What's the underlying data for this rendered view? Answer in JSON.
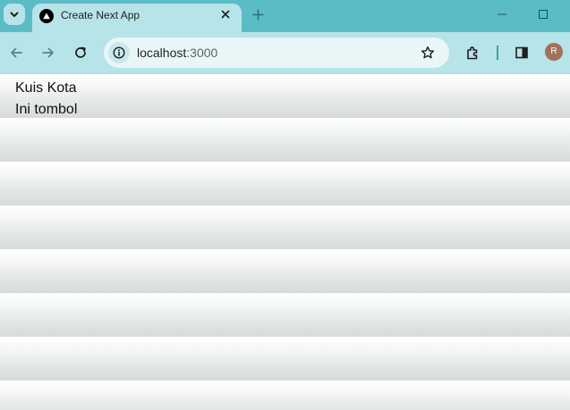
{
  "tab": {
    "title": "Create Next App",
    "favicon": "nextjs-triangle-icon"
  },
  "toolbar": {
    "url_host": "localhost",
    "url_port": ":3000",
    "avatar_letter": "R"
  },
  "page": {
    "heading": "Kuis Kota",
    "button_text": "Ini tombol"
  },
  "colors": {
    "tabstrip": "#5bbcc6",
    "toolbar": "#b7e4e8",
    "omnibox": "#e9f6f7",
    "avatar": "#a3705c"
  }
}
